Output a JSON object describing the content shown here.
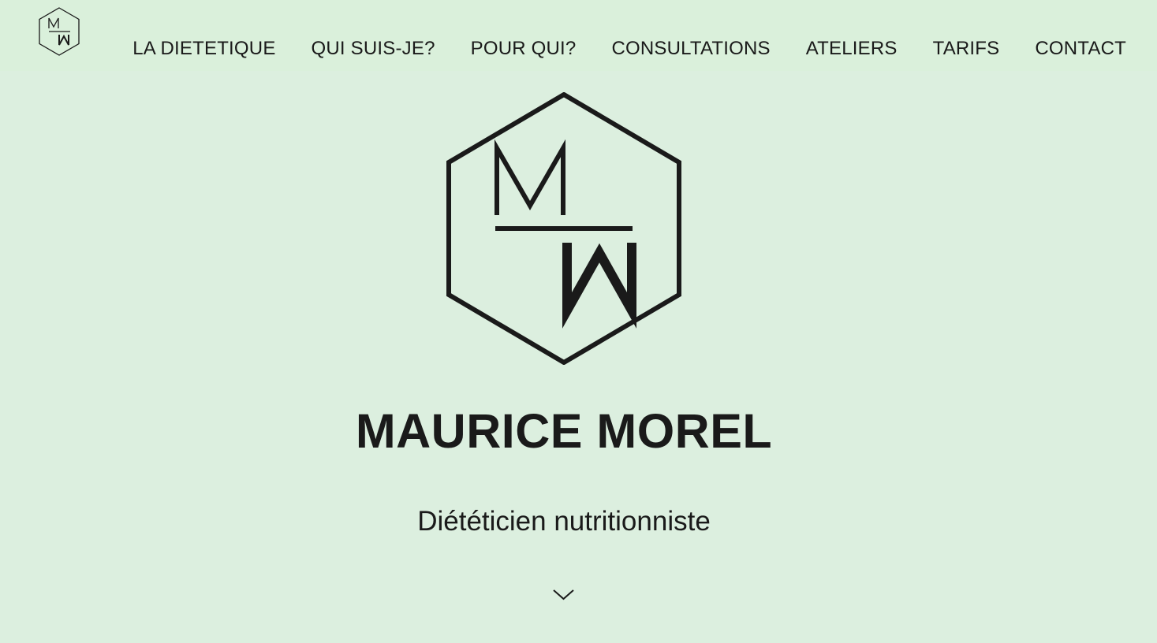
{
  "header": {
    "logo_icon": "mw-hexagon-logo",
    "nav": [
      {
        "label": "LA DIETETIQUE"
      },
      {
        "label": "QUI SUIS-JE?"
      },
      {
        "label": "POUR QUI?"
      },
      {
        "label": "CONSULTATIONS"
      },
      {
        "label": "ATELIERS"
      },
      {
        "label": "TARIFS"
      },
      {
        "label": "CONTACT"
      }
    ]
  },
  "hero": {
    "logo_icon": "mw-hexagon-logo",
    "logo_letters": [
      "M",
      "W"
    ],
    "name": "MAURICE MOREL",
    "subtitle": "Diététicien nutritionniste",
    "scroll_icon": "chevron-down-icon"
  },
  "colors": {
    "background": "#dcefdf",
    "header_background": "#daf0db",
    "text": "#1a1a1a"
  }
}
